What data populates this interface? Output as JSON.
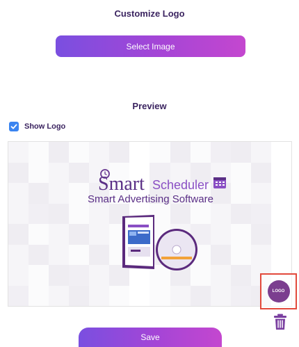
{
  "customize": {
    "title": "Customize Logo",
    "select_button": "Select Image"
  },
  "preview": {
    "title": "Preview",
    "show_logo_label": "Show Logo",
    "show_logo_checked": true,
    "brand_prefix": "Smart",
    "brand_suffix": "Scheduler",
    "tagline": "Smart Advertising Software",
    "logo_badge_text": "LOGO"
  },
  "actions": {
    "save_button": "Save",
    "delete_icon": "trash-icon"
  },
  "colors": {
    "accent_start": "#7a4fe0",
    "accent_end": "#c447cf",
    "checkbox": "#3a84f0",
    "highlight": "#e2493b",
    "logo_badge": "#7b3e8f"
  }
}
